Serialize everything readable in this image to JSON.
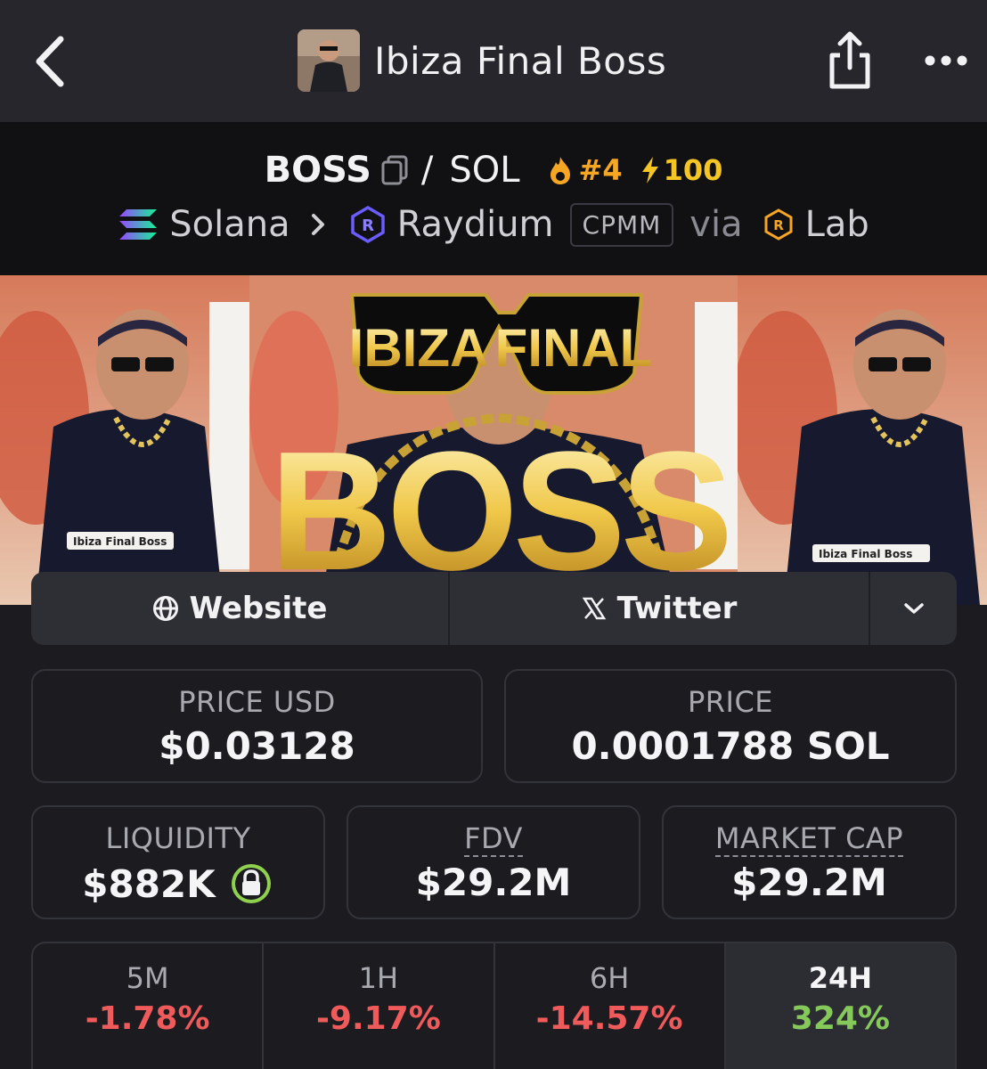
{
  "nav": {
    "title": "Ibiza Final Boss"
  },
  "pair": {
    "base": "BOSS",
    "separator": "/",
    "quote": "SOL",
    "rank": "#4",
    "boost": "100"
  },
  "chain": {
    "network": "Solana",
    "dex": "Raydium",
    "pool_type": "CPMM",
    "via": "via",
    "launchpad": "Lab"
  },
  "banner": {
    "line1_left": "IBIZA",
    "line1_right": "FINAL",
    "line2": "BOSS",
    "caption_left": "Ibiza Final Boss",
    "caption_right": "Ibiza Final Boss"
  },
  "links": {
    "website": "Website",
    "twitter": "Twitter"
  },
  "price": {
    "usd_label": "PRICE USD",
    "usd_value": "$0.03128",
    "native_label": "PRICE",
    "native_value": "0.0001788 SOL"
  },
  "stats": {
    "liquidity_label": "LIQUIDITY",
    "liquidity_value": "$882K",
    "fdv_label": "FDV",
    "fdv_value": "$29.2M",
    "mcap_label": "MARKET CAP",
    "mcap_value": "$29.2M"
  },
  "timeframes": [
    {
      "label": "5M",
      "change": "-1.78%"
    },
    {
      "label": "1H",
      "change": "-9.17%"
    },
    {
      "label": "6H",
      "change": "-14.57%"
    },
    {
      "label": "24H",
      "change": "324%"
    }
  ],
  "colors": {
    "negative": "#ef5a5a",
    "positive": "#86c95b",
    "rank": "#f5a623",
    "lock": "#8fd14f"
  }
}
